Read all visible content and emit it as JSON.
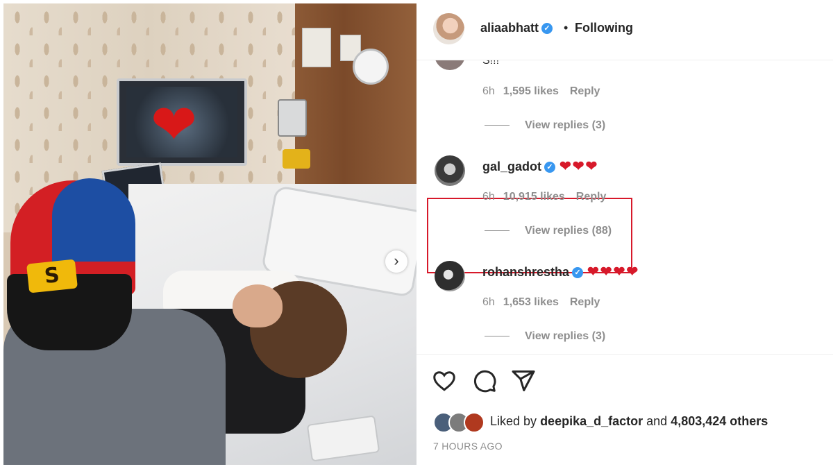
{
  "post": {
    "carousel_next_label": "›"
  },
  "header": {
    "username": "aliaabhatt",
    "verified_mark": "✓",
    "separator": "•",
    "follow_status": "Following"
  },
  "comments": {
    "partial_comment": {
      "text": "S!!!",
      "time": "6h",
      "likes": "1,595 likes",
      "reply": "Reply",
      "view_replies": "View replies (3)"
    },
    "items": [
      {
        "username": "gal_gadot",
        "verified_mark": "✓",
        "text": "❤❤❤",
        "time": "6h",
        "likes": "10,915 likes",
        "reply": "Reply",
        "view_replies": "View replies (88)",
        "highlighted": true
      },
      {
        "username": "rohanshrestha",
        "verified_mark": "✓",
        "text": "❤❤❤❤",
        "time": "6h",
        "likes": "1,653 likes",
        "reply": "Reply",
        "view_replies": "View replies (3)",
        "highlighted": false
      }
    ]
  },
  "actions": {
    "icons": [
      "heart-icon",
      "comment-icon",
      "share-icon"
    ],
    "liked_by_prefix": "Liked by",
    "liked_by_user": "deepika_d_factor",
    "liked_by_and": "and",
    "liked_by_count": "4,803,424 others",
    "timestamp": "7 HOURS AGO"
  },
  "colors": {
    "verified": "#3897f0",
    "highlight_border": "#d7192a",
    "heart": "#d7192a",
    "muted_text": "#8e8e8e"
  }
}
